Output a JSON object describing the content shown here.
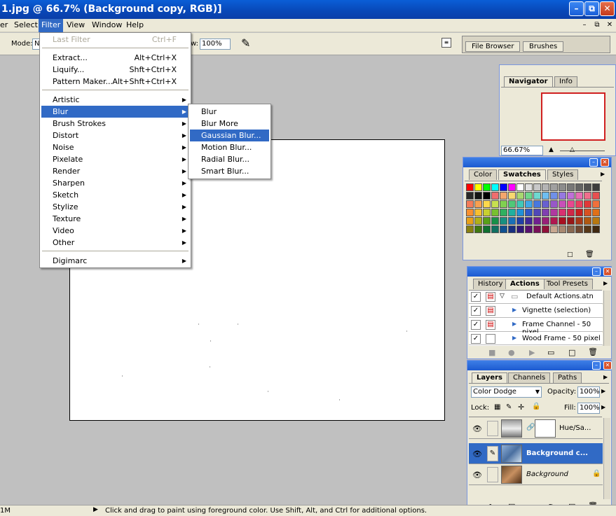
{
  "window": {
    "title": "1.jpg @ 66.7% (Background copy, RGB)]"
  },
  "menubar": {
    "items": [
      "er",
      "Select",
      "Filter",
      "View",
      "Window",
      "Help"
    ]
  },
  "options": {
    "mode_label": "Mode:",
    "mode_value": "N",
    "flow_label": "w:",
    "flow_value": "100%",
    "tabs": [
      "File Browser",
      "Brushes"
    ]
  },
  "filter_menu": {
    "top": [
      {
        "label": "Last Filter",
        "shortcut": "Ctrl+F",
        "disabled": true
      },
      {
        "label": "Extract...",
        "shortcut": "Alt+Ctrl+X"
      },
      {
        "label": "Liquify...",
        "shortcut": "Shft+Ctrl+X"
      },
      {
        "label": "Pattern Maker...",
        "shortcut": "Alt+Shft+Ctrl+X"
      }
    ],
    "groups": [
      "Artistic",
      "Blur",
      "Brush Strokes",
      "Distort",
      "Noise",
      "Pixelate",
      "Render",
      "Sharpen",
      "Sketch",
      "Stylize",
      "Texture",
      "Video",
      "Other"
    ],
    "bottom": "Digimarc"
  },
  "blur_menu": {
    "items": [
      "Blur",
      "Blur More",
      "Gaussian Blur...",
      "Motion Blur...",
      "Radial Blur...",
      "Smart Blur..."
    ],
    "selected": "Gaussian Blur..."
  },
  "navigator": {
    "tabs": [
      "Navigator",
      "Info"
    ],
    "zoom": "66.67%"
  },
  "swatches": {
    "tabs": [
      "Color",
      "Swatches",
      "Styles"
    ],
    "rows": [
      [
        "#ff0000",
        "#ffff00",
        "#00ff00",
        "#00ffff",
        "#0000ff",
        "#ff00ff",
        "#ffffff",
        "#e0e0e0",
        "#c8c8c8",
        "#b4b4b4",
        "#a0a0a0",
        "#8c8c8c",
        "#787878",
        "#646464",
        "#505050",
        "#3c3c3c"
      ],
      [
        "#282828",
        "#141414",
        "#000000",
        "#f06e6e",
        "#f4a66c",
        "#f8d870",
        "#a8d870",
        "#6ed88c",
        "#6ed8d0",
        "#6ebef0",
        "#7090e8",
        "#9678e0",
        "#c070d8",
        "#e86eb4",
        "#f06e8c",
        "#e85050"
      ],
      [
        "#f47c5a",
        "#f8a050",
        "#fcd84c",
        "#c8e050",
        "#80d050",
        "#50c878",
        "#40c8b8",
        "#40a8e8",
        "#4878e0",
        "#6860d0",
        "#9858c8",
        "#c850b8",
        "#e84890",
        "#e84060",
        "#e03838",
        "#f0703c"
      ],
      [
        "#f89030",
        "#f8c030",
        "#c8d030",
        "#78c030",
        "#30b060",
        "#20b0a0",
        "#2090d8",
        "#3058c8",
        "#5048b8",
        "#8040b0",
        "#b038a0",
        "#d83070",
        "#d02848",
        "#c82020",
        "#d85020",
        "#e07018"
      ],
      [
        "#e8a018",
        "#b0b018",
        "#58a018",
        "#189048",
        "#189080",
        "#1870b8",
        "#2040a8",
        "#402898",
        "#702090",
        "#982078",
        "#b01850",
        "#a81020",
        "#981818",
        "#a83818",
        "#b05810",
        "#b87810"
      ],
      [
        "#888010",
        "#407810",
        "#107030",
        "#107060",
        "#105090",
        "#183080",
        "#301878",
        "#581070",
        "#781058",
        "#901038",
        "#c8a890",
        "#a88870",
        "#886850",
        "#704830",
        "#583818",
        "#402810"
      ]
    ]
  },
  "history": {
    "tabs": [
      "History",
      "Actions",
      "Tool Presets"
    ],
    "rows": [
      "Default Actions.atn",
      "Vignette (selection)",
      "Frame Channel - 50 pixel",
      "Wood Frame - 50 pixel"
    ]
  },
  "layers": {
    "tabs": [
      "Layers",
      "Channels",
      "Paths"
    ],
    "blend": "Color Dodge",
    "opacity_label": "Opacity:",
    "opacity": "100%",
    "lock_label": "Lock:",
    "fill_label": "Fill:",
    "fill": "100%",
    "items": [
      {
        "name": "Hue/Sa...",
        "selected": false
      },
      {
        "name": "Background c...",
        "selected": true
      },
      {
        "name": "Background",
        "selected": false
      }
    ]
  },
  "status": {
    "size": "1M",
    "hint": "Click and drag to paint using foreground color.  Use Shift, Alt, and Ctrl for additional options."
  },
  "colors": {
    "accent": "#316ac5",
    "title": "#0a5ed7",
    "chrome": "#ece9d8",
    "workspace": "#c0c0c0"
  }
}
